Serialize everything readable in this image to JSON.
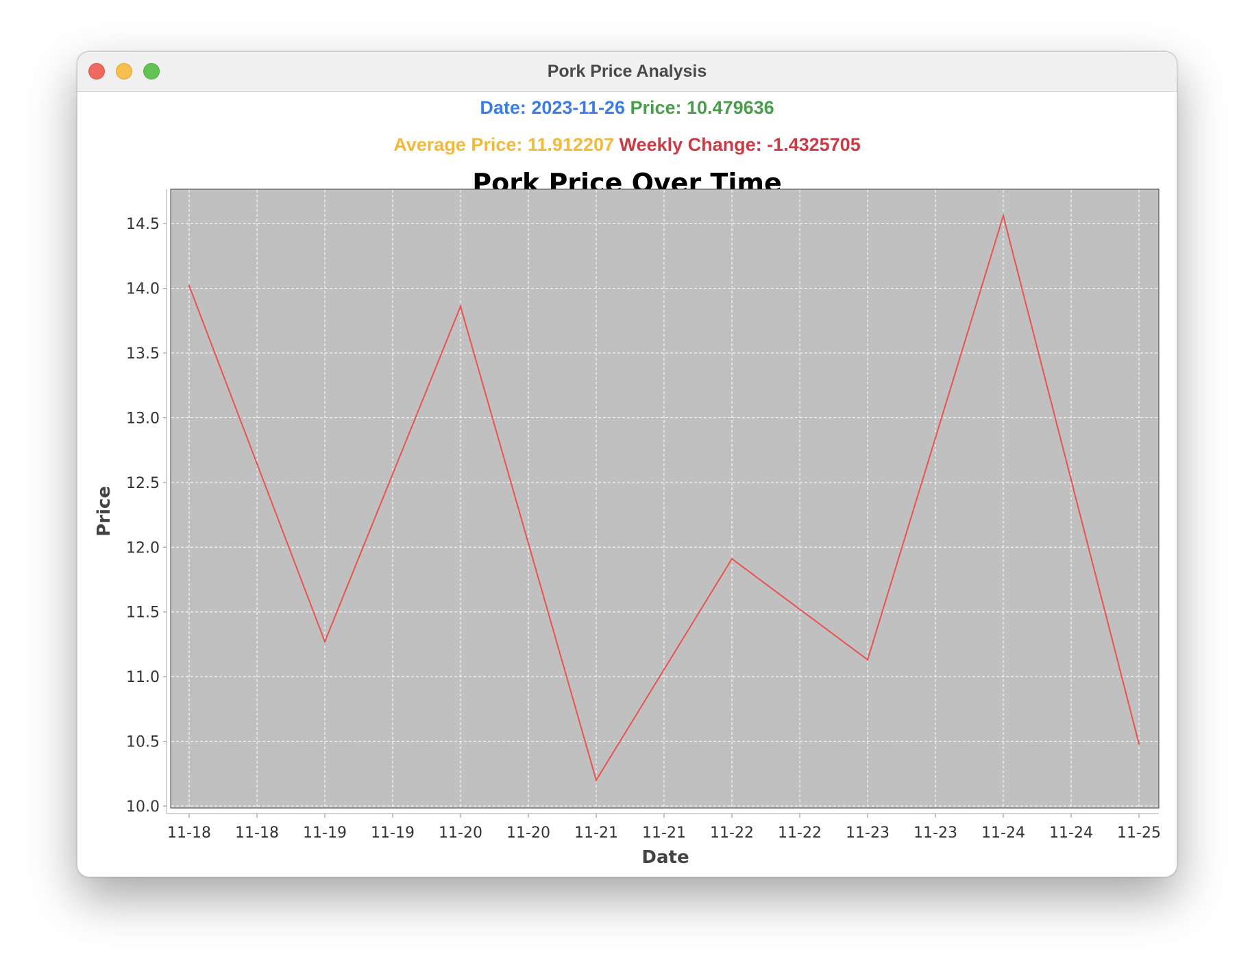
{
  "window": {
    "title": "Pork Price Analysis"
  },
  "info": {
    "date_label": "Date: 2023-11-26",
    "price_label": "Price: 10.479636",
    "average_label": "Average Price: 11.912207",
    "weekly_change_label": "Weekly Change: -1.4325705",
    "colors": {
      "date": "#3a7ce8",
      "price": "#4a9e4a",
      "average": "#f3b93c",
      "weekly_change": "#cc3b45"
    }
  },
  "chart_data": {
    "type": "line",
    "title": "Pork Price Over Time",
    "xlabel": "Date",
    "ylabel": "Price",
    "x_tick_labels": [
      "11-18",
      "11-18",
      "11-19",
      "11-19",
      "11-20",
      "11-20",
      "11-21",
      "11-21",
      "11-22",
      "11-22",
      "11-23",
      "11-23",
      "11-24",
      "11-24",
      "11-25"
    ],
    "x": [
      "2023-11-18",
      "2023-11-19",
      "2023-11-20",
      "2023-11-21",
      "2023-11-22",
      "2023-11-23",
      "2023-11-24",
      "2023-11-25"
    ],
    "series": [
      {
        "values": [
          14.02,
          11.27,
          13.86,
          10.2,
          11.91,
          11.13,
          14.56,
          10.48
        ]
      }
    ],
    "ylim": [
      10.0,
      14.75
    ],
    "y_ticks": [
      10.0,
      10.5,
      11.0,
      11.5,
      12.0,
      12.5,
      13.0,
      13.5,
      14.0,
      14.5
    ],
    "grid": true,
    "colors": {
      "line": "#e8524f",
      "plot_background": "#c0c0c0",
      "grid": "#ffffff"
    }
  }
}
